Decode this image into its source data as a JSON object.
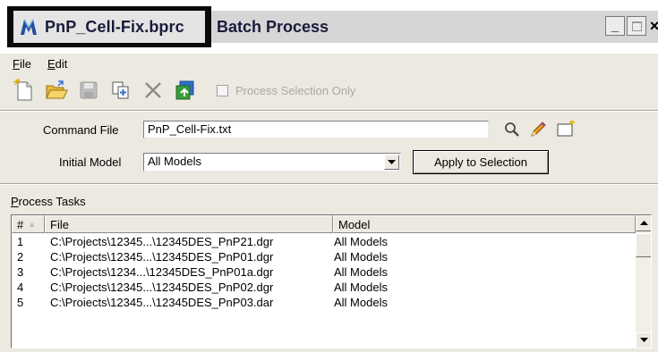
{
  "window": {
    "file_title": "PnP_Cell-Fix.bprc",
    "app_title": "Batch Process",
    "controls": {
      "minimize": "_",
      "close": "×"
    }
  },
  "menu": [
    {
      "label": "File",
      "mnemonic": "F"
    },
    {
      "label": "Edit",
      "mnemonic": "E"
    }
  ],
  "toolbar": {
    "icons": [
      "new-file-icon",
      "open-folder-icon",
      "save-icon",
      "add-tasks-icon",
      "delete-icon",
      "run-batch-icon"
    ],
    "process_selection_label": "Process Selection Only",
    "process_selection_checked": false
  },
  "command_file": {
    "label": "Command File",
    "value": "PnP_Cell-Fix.txt",
    "icons": [
      "browse-magnifier-icon",
      "edit-pencil-icon",
      "new-command-file-icon"
    ]
  },
  "initial_model": {
    "label": "Initial Model",
    "value": "All Models"
  },
  "apply_button": "Apply to Selection",
  "process_tasks": {
    "label": "Process Tasks",
    "columns": {
      "num": "#",
      "file": "File",
      "model": "Model"
    },
    "rows": [
      {
        "num": "1",
        "file": "C:\\Projects\\12345...\\12345DES_PnP21.dgr",
        "model": "All Models"
      },
      {
        "num": "2",
        "file": "C:\\Projects\\12345...\\12345DES_PnP01.dgr",
        "model": "All Models"
      },
      {
        "num": "3",
        "file": "C:\\Projects\\1234...\\12345DES_PnP01a.dgr",
        "model": "All Models"
      },
      {
        "num": "4",
        "file": "C:\\Projects\\12345...\\12345DES_PnP02.dgr",
        "model": "All Models"
      },
      {
        "num": "5",
        "file": "C:\\Proiects\\12345...\\12345DES_PnP03.dar",
        "model": "All Models"
      }
    ]
  },
  "colors": {
    "dialog_bg": "#ece9e1",
    "title_highlight": "#0a0a0a",
    "disabled_text": "#a8a8a8",
    "run_icon_green": "#3a9a3a",
    "run_icon_blue": "#2f6fcf"
  }
}
